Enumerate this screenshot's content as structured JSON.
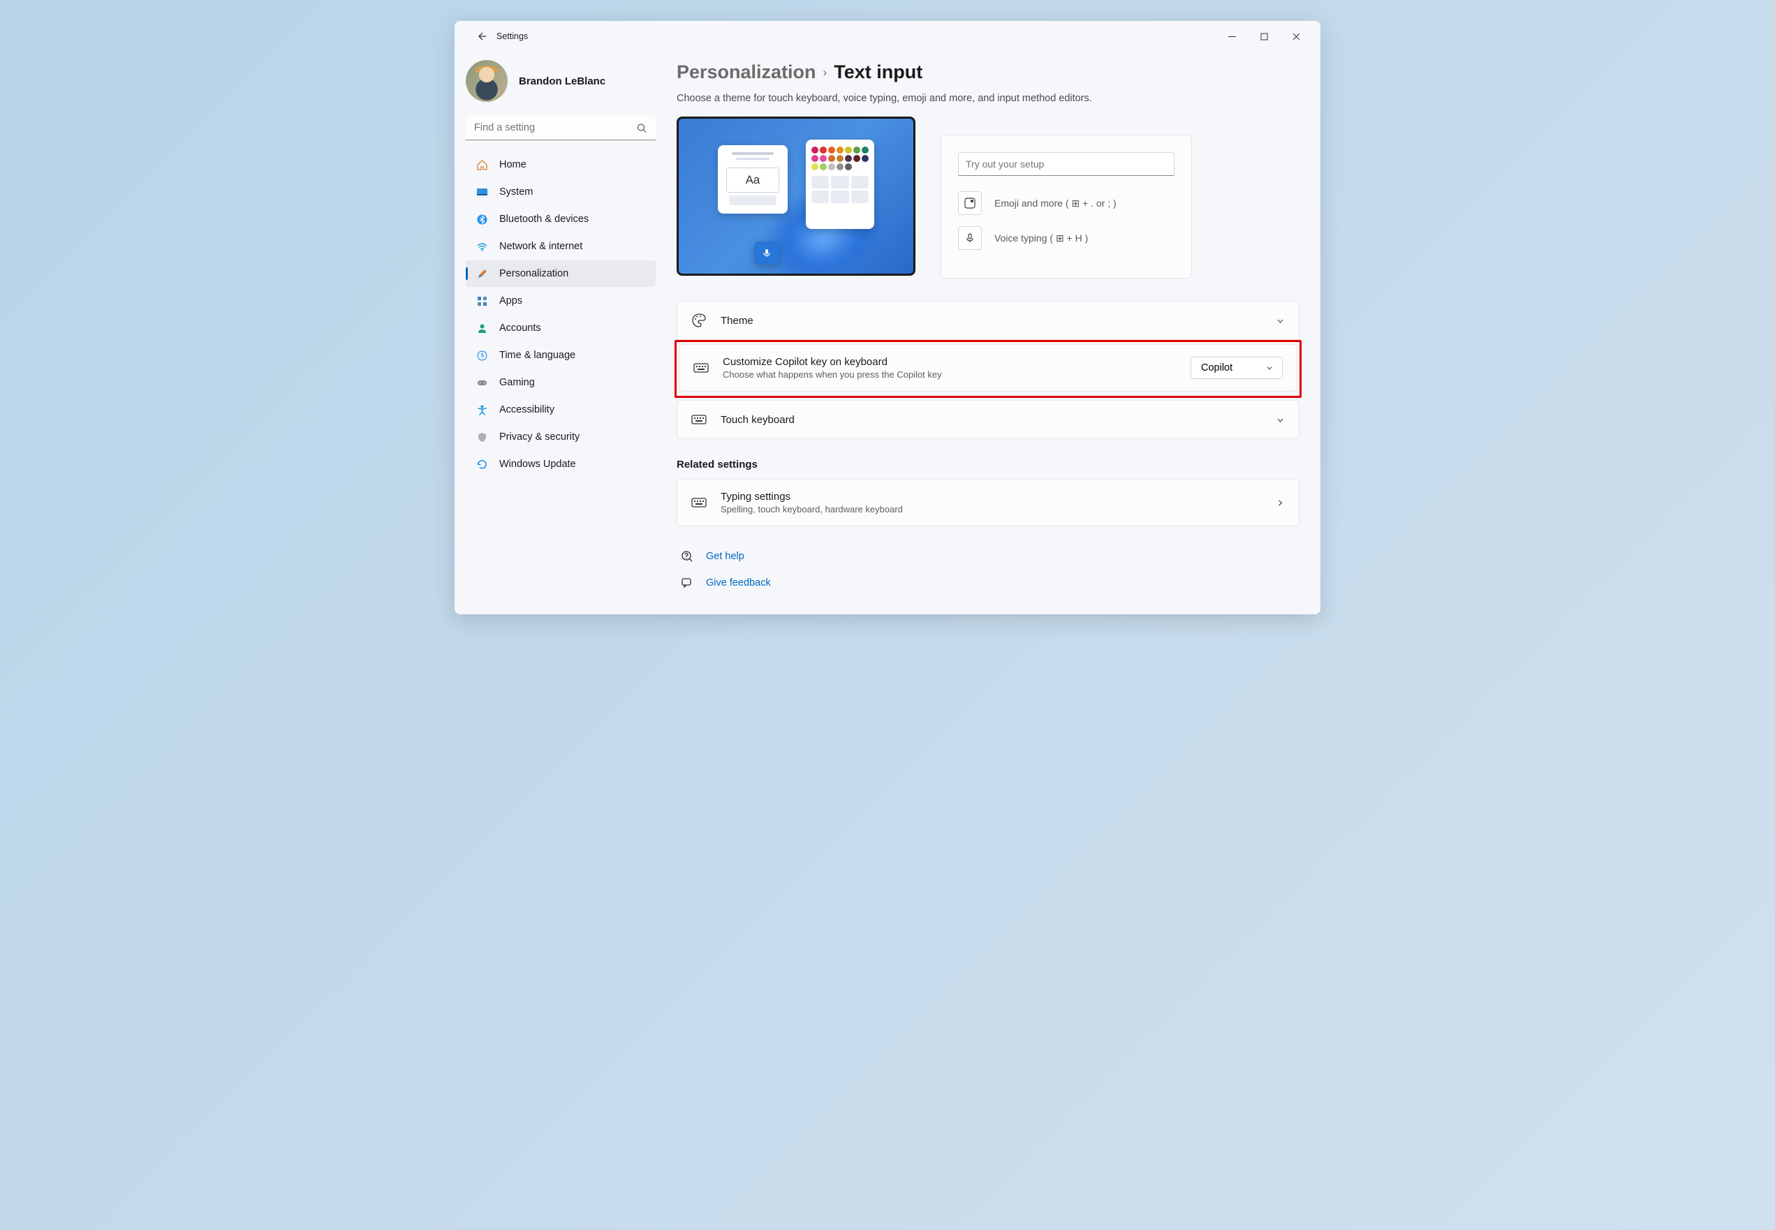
{
  "window": {
    "title": "Settings"
  },
  "user": {
    "name": "Brandon LeBlanc"
  },
  "search": {
    "placeholder": "Find a setting"
  },
  "nav": [
    {
      "key": "home",
      "label": "Home"
    },
    {
      "key": "system",
      "label": "System"
    },
    {
      "key": "bluetooth",
      "label": "Bluetooth & devices"
    },
    {
      "key": "network",
      "label": "Network & internet"
    },
    {
      "key": "personalization",
      "label": "Personalization",
      "active": true
    },
    {
      "key": "apps",
      "label": "Apps"
    },
    {
      "key": "accounts",
      "label": "Accounts"
    },
    {
      "key": "time",
      "label": "Time & language"
    },
    {
      "key": "gaming",
      "label": "Gaming"
    },
    {
      "key": "accessibility",
      "label": "Accessibility"
    },
    {
      "key": "privacy",
      "label": "Privacy & security"
    },
    {
      "key": "update",
      "label": "Windows Update"
    }
  ],
  "breadcrumb": {
    "parent": "Personalization",
    "current": "Text input"
  },
  "description": "Choose a theme for touch keyboard, voice typing, emoji and more, and input method editors.",
  "preview": {
    "aa_label": "Aa"
  },
  "tryout": {
    "placeholder": "Try out your setup",
    "emoji_label": "Emoji and more ( ⊞ + . or ; )",
    "voice_label": "Voice typing ( ⊞ + H )"
  },
  "cards": {
    "theme": {
      "title": "Theme"
    },
    "copilot": {
      "title": "Customize Copilot key on keyboard",
      "sub": "Choose what happens when you press the Copilot key",
      "selected": "Copilot"
    },
    "touch": {
      "title": "Touch keyboard"
    }
  },
  "related": {
    "heading": "Related settings",
    "typing": {
      "title": "Typing settings",
      "sub": "Spelling, touch keyboard, hardware keyboard"
    }
  },
  "help": {
    "get_help": "Get help",
    "feedback": "Give feedback"
  }
}
